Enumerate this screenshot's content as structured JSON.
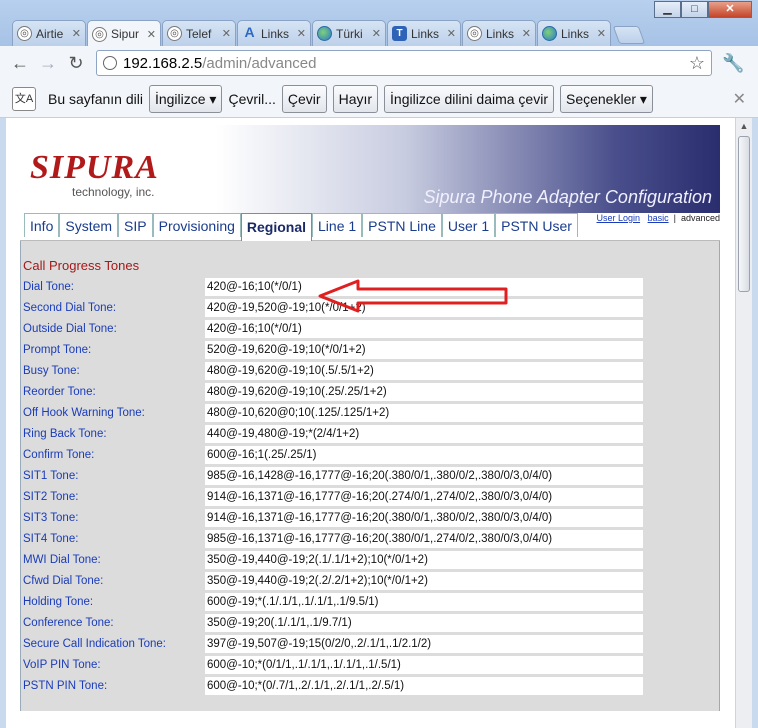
{
  "window": {
    "minimize": "▁",
    "maximize": "□",
    "close": "✕"
  },
  "tabs": [
    {
      "label": "Airtie",
      "icon": "globe-gray"
    },
    {
      "label": "Sipur",
      "icon": "globe-gray",
      "active": true
    },
    {
      "label": "Telef",
      "icon": "globe-gray"
    },
    {
      "label": "Links",
      "icon": "a-icon"
    },
    {
      "label": "Türki",
      "icon": "globe-color"
    },
    {
      "label": "Links",
      "icon": "t-icon"
    },
    {
      "label": "Links",
      "icon": "globe-gray"
    },
    {
      "label": "Links",
      "icon": "globe-color"
    }
  ],
  "address": {
    "host": "192.168.2.5",
    "path": "/admin/advanced"
  },
  "translate_bar": {
    "icon": "文A",
    "prompt": "Bu sayfanın dili",
    "language": "İngilizce ▾",
    "question": "Çevril...",
    "translate": "Çevir",
    "no": "Hayır",
    "always": "İngilizce dilini daima çevir",
    "options": "Seçenekler ▾",
    "close": "✕"
  },
  "spa": {
    "logo": "SIPURA",
    "logo_sub": "technology, inc.",
    "title": "Sipura Phone Adapter Configuration",
    "nav": [
      "Info",
      "System",
      "SIP",
      "Provisioning",
      "Regional",
      "Line 1",
      "PSTN Line",
      "User 1",
      "PSTN User"
    ],
    "active_nav": "Regional",
    "mode_links": {
      "user_login": "User Login",
      "basic": "basic",
      "sep": "|",
      "advanced": "advanced"
    },
    "section": "Call Progress Tones",
    "rows": [
      {
        "label": "Dial Tone:",
        "value": "420@-16;10(*/0/1)"
      },
      {
        "label": "Second Dial Tone:",
        "value": "420@-19,520@-19;10(*/0/1+2)"
      },
      {
        "label": "Outside Dial Tone:",
        "value": "420@-16;10(*/0/1)"
      },
      {
        "label": "Prompt Tone:",
        "value": "520@-19,620@-19;10(*/0/1+2)"
      },
      {
        "label": "Busy Tone:",
        "value": "480@-19,620@-19;10(.5/.5/1+2)"
      },
      {
        "label": "Reorder Tone:",
        "value": "480@-19,620@-19;10(.25/.25/1+2)"
      },
      {
        "label": "Off Hook Warning Tone:",
        "value": "480@-10,620@0;10(.125/.125/1+2)"
      },
      {
        "label": "Ring Back Tone:",
        "value": "440@-19,480@-19;*(2/4/1+2)"
      },
      {
        "label": "Confirm Tone:",
        "value": "600@-16;1(.25/.25/1)"
      },
      {
        "label": "SIT1 Tone:",
        "value": "985@-16,1428@-16,1777@-16;20(.380/0/1,.380/0/2,.380/0/3,0/4/0)"
      },
      {
        "label": "SIT2 Tone:",
        "value": "914@-16,1371@-16,1777@-16;20(.274/0/1,.274/0/2,.380/0/3,0/4/0)"
      },
      {
        "label": "SIT3 Tone:",
        "value": "914@-16,1371@-16,1777@-16;20(.380/0/1,.380/0/2,.380/0/3,0/4/0)"
      },
      {
        "label": "SIT4 Tone:",
        "value": "985@-16,1371@-16,1777@-16;20(.380/0/1,.274/0/2,.380/0/3,0/4/0)"
      },
      {
        "label": "MWI Dial Tone:",
        "value": "350@-19,440@-19;2(.1/.1/1+2);10(*/0/1+2)"
      },
      {
        "label": "Cfwd Dial Tone:",
        "value": "350@-19,440@-19;2(.2/.2/1+2);10(*/0/1+2)"
      },
      {
        "label": "Holding Tone:",
        "value": "600@-19;*(.1/.1/1,.1/.1/1,.1/9.5/1)"
      },
      {
        "label": "Conference Tone:",
        "value": "350@-19;20(.1/.1/1,.1/9.7/1)"
      },
      {
        "label": "Secure Call Indication Tone:",
        "value": "397@-19,507@-19;15(0/2/0,.2/.1/1,.1/2.1/2)"
      },
      {
        "label": "VoIP PIN Tone:",
        "value": "600@-10;*(0/1/1,.1/.1/1,.1/.1/1,.1/.5/1)"
      },
      {
        "label": "PSTN PIN Tone:",
        "value": "600@-10;*(0/.7/1,.2/.1/1,.2/.1/1,.2/.5/1)"
      }
    ]
  },
  "colors": {
    "annotation_arrow": "#e02020"
  }
}
